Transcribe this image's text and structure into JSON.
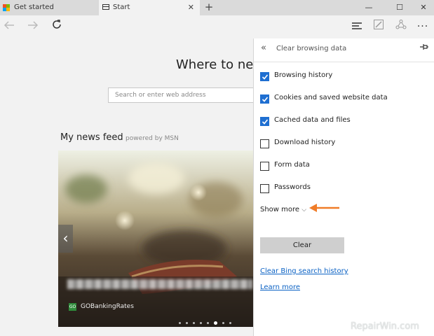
{
  "tabs": [
    {
      "label": "Get started",
      "icon": "microsoft-logo-icon",
      "active": false
    },
    {
      "label": "Start",
      "icon": "page-icon",
      "active": true
    }
  ],
  "start_page": {
    "heading": "Where to next?",
    "search_placeholder": "Search or enter web address",
    "feed_title": "My news feed",
    "feed_powered": "powered by MSN",
    "card_source": "GOBankingRates",
    "carousel_dots": 8,
    "carousel_active_index": 5
  },
  "panel": {
    "title": "Clear browsing data",
    "options": [
      {
        "label": "Browsing history",
        "checked": true
      },
      {
        "label": "Cookies and saved website data",
        "checked": true
      },
      {
        "label": "Cached data and files",
        "checked": true
      },
      {
        "label": "Download history",
        "checked": false
      },
      {
        "label": "Form data",
        "checked": false
      },
      {
        "label": "Passwords",
        "checked": false
      }
    ],
    "show_more": "Show more",
    "clear_button": "Clear",
    "link_bing": "Clear Bing search history",
    "link_learn": "Learn more"
  },
  "colors": {
    "accent": "#1f6fd1",
    "annotation_arrow": "#f07c28",
    "link": "#0b62c4"
  },
  "watermark": "RepairWin.com"
}
